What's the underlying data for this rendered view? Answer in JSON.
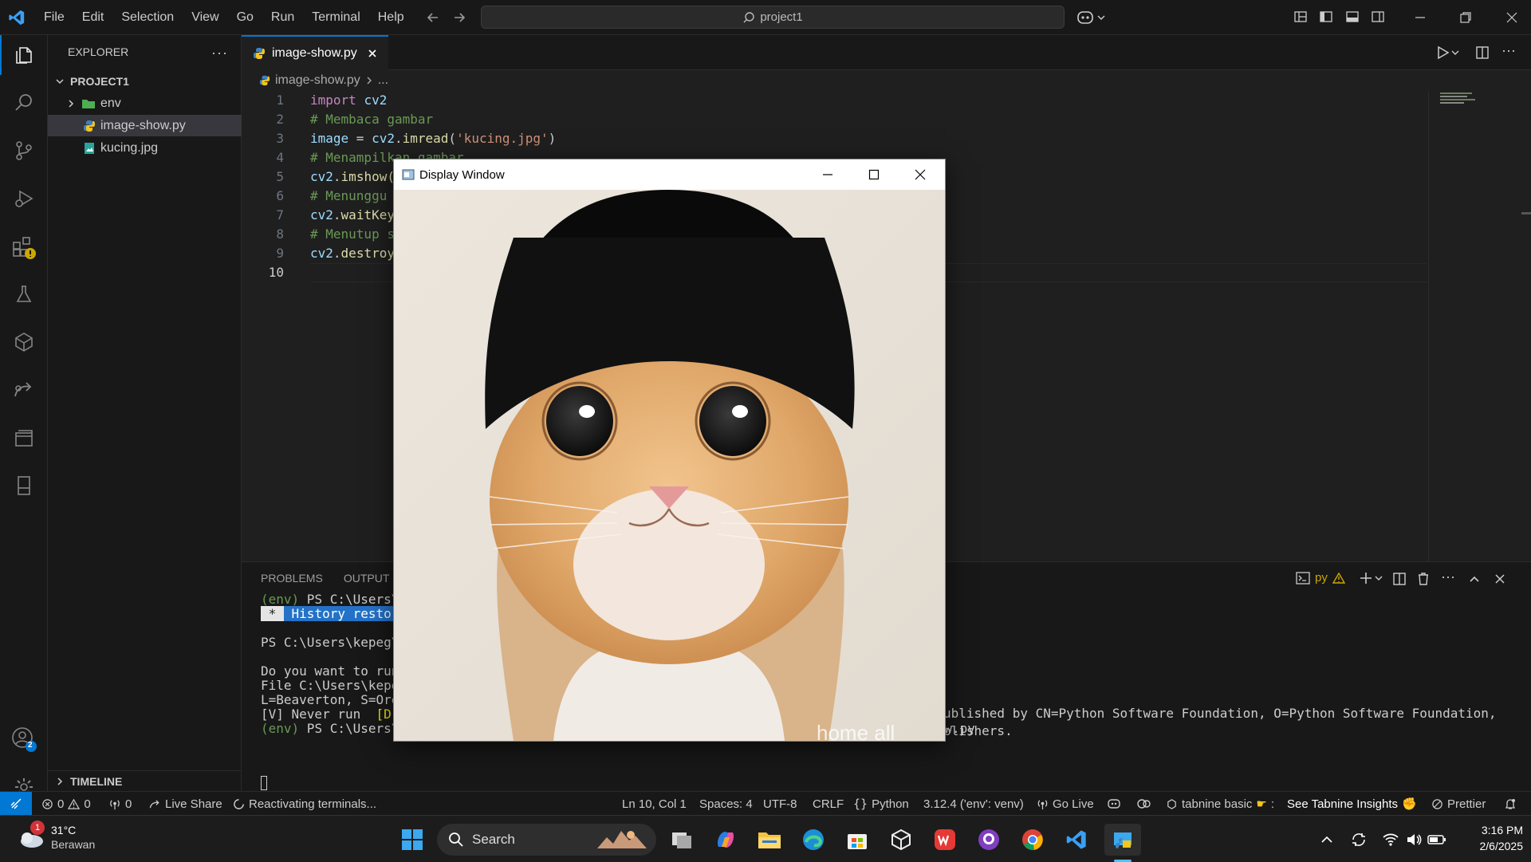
{
  "titlebar": {
    "menu": [
      "File",
      "Edit",
      "Selection",
      "View",
      "Go",
      "Run",
      "Terminal",
      "Help"
    ],
    "search_label": "project1"
  },
  "sidebar": {
    "title": "EXPLORER",
    "project": "PROJECT1",
    "items": [
      {
        "label": "env",
        "kind": "folder"
      },
      {
        "label": "image-show.py",
        "kind": "python"
      },
      {
        "label": "kucing.jpg",
        "kind": "image"
      }
    ],
    "timeline": "TIMELINE"
  },
  "editor": {
    "tab": "image-show.py",
    "breadcrumb": [
      "image-show.py",
      "..."
    ],
    "lines": [
      {
        "n": "1",
        "parts": [
          [
            "kw",
            "import"
          ],
          [
            "tx",
            " "
          ],
          [
            "id",
            "cv2"
          ]
        ]
      },
      {
        "n": "2",
        "parts": [
          [
            "cm",
            "# Membaca gambar"
          ]
        ]
      },
      {
        "n": "3",
        "parts": [
          [
            "id",
            "image"
          ],
          [
            "tx",
            " = "
          ],
          [
            "id",
            "cv2"
          ],
          [
            "tx",
            "."
          ],
          [
            "fn",
            "imread"
          ],
          [
            "tx",
            "("
          ],
          [
            "st",
            "'kucing.jpg'"
          ],
          [
            "tx",
            ")"
          ]
        ]
      },
      {
        "n": "4",
        "parts": [
          [
            "cm",
            "# Menampilkan gambar"
          ]
        ]
      },
      {
        "n": "5",
        "parts": [
          [
            "id",
            "cv2"
          ],
          [
            "tx",
            "."
          ],
          [
            "fn",
            "imshow("
          ]
        ]
      },
      {
        "n": "6",
        "parts": [
          [
            "cm",
            "# Menunggu "
          ]
        ]
      },
      {
        "n": "7",
        "parts": [
          [
            "id",
            "cv2"
          ],
          [
            "tx",
            "."
          ],
          [
            "fn",
            "waitKey"
          ]
        ]
      },
      {
        "n": "8",
        "parts": [
          [
            "cm",
            "# Menutup s"
          ]
        ]
      },
      {
        "n": "9",
        "parts": [
          [
            "id",
            "cv2"
          ],
          [
            "tx",
            "."
          ],
          [
            "fn",
            "destroy"
          ]
        ]
      },
      {
        "n": "10",
        "parts": []
      }
    ]
  },
  "panel": {
    "tabs": [
      "PROBLEMS",
      "OUTPUT"
    ],
    "shell_label": "py",
    "terminal": [
      [
        [
          "#6a9955",
          "(env)"
        ],
        [
          "#ccc",
          " PS C:\\Users\\"
        ]
      ],
      [
        [
          "#ccc",
          " * "
        ],
        [
          "#ccc",
          " History restor"
        ]
      ],
      [],
      [
        [
          "#ccc",
          "PS C:\\Users\\kepeg\\"
        ]
      ],
      [],
      [
        [
          "#ccc",
          "Do you want to run"
        ]
      ],
      [
        [
          "#ccc",
          "File C:\\Users\\kepe"
        ]
      ],
      [
        [
          "#ccc",
          "L=Beaverton, S=Ore"
        ]
      ],
      [
        [
          "#ccc",
          "[V] Never run  "
        ],
        [
          "#e5e510",
          "[D] Do not run"
        ],
        [
          "#ccc",
          "  [R] Run once  [A] Always run  [?] Help (default is \"D\"): R"
        ]
      ],
      [
        [
          "#6a9955",
          "(env)"
        ],
        [
          "#ccc",
          " PS C:\\Users\\kepeg\\Documents\\Ami\\smt 5\\pengolahan citra\\project1> "
        ],
        [
          "#e5e510",
          "py.exe"
        ],
        [
          "#ccc",
          " .\\image-show.py"
        ]
      ]
    ],
    "terminal_tail": [
      "ublished by CN=Python Software Foundation, O=Python Software Foundation,",
      "blishers."
    ]
  },
  "statusbar": {
    "errors": "0",
    "warnings": "0",
    "ports": "0",
    "live_share": "Live Share",
    "activity": "Reactivating terminals...",
    "cursor": "Ln 10, Col 1",
    "spaces": "Spaces: 4",
    "encoding": "UTF-8",
    "eol": "CRLF",
    "language": "Python",
    "interpreter": "3.12.4 ('env': venv)",
    "go_live": "Go Live",
    "tabnine": "tabnine basic",
    "tabnine_insights": "See Tabnine Insights",
    "prettier": "Prettier"
  },
  "cv_window": {
    "title": "Display Window",
    "caption_partial": "home all"
  },
  "taskbar": {
    "weather_temp": "31°C",
    "weather_desc": "Berawan",
    "weather_badge": "1",
    "search": "Search",
    "time": "3:16 PM",
    "date": "2/6/2025"
  },
  "accounts_badge": "2",
  "accent_color": "#0078d4"
}
